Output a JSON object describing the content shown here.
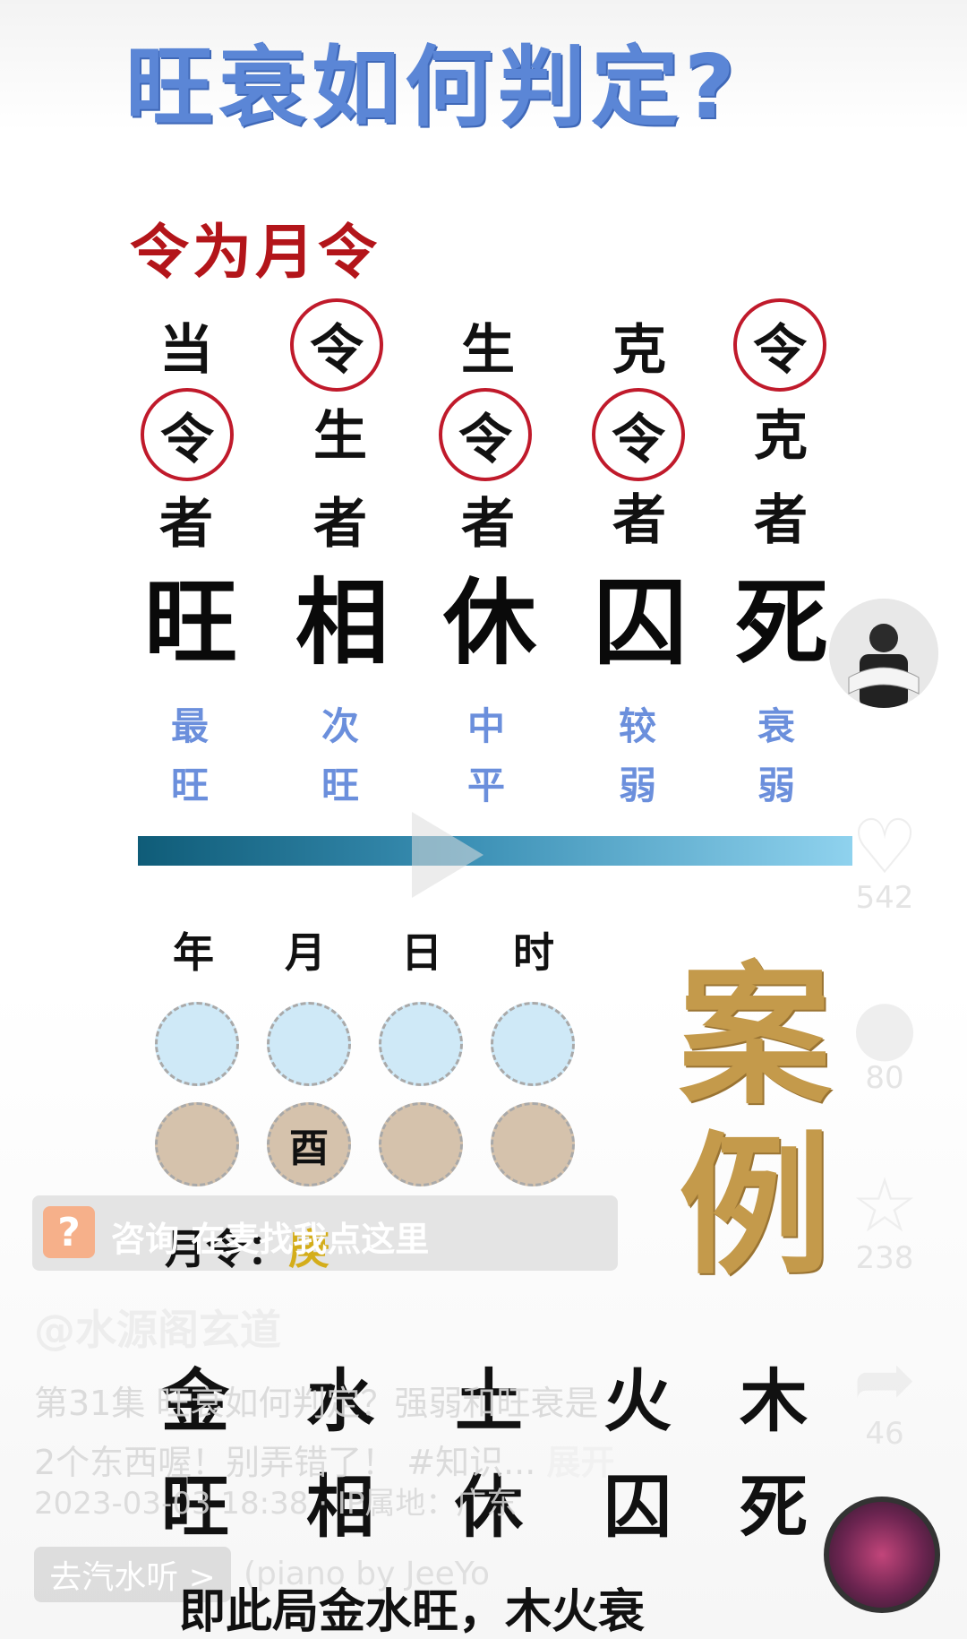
{
  "title": "旺衰如何判定?",
  "subtitle": "令为月令",
  "grid": {
    "row1": [
      "当",
      "令",
      "生",
      "克",
      "令"
    ],
    "row2": [
      "令",
      "生",
      "令",
      "令",
      "克"
    ],
    "row3": [
      "者",
      "者",
      "者",
      "者",
      "者"
    ],
    "states": [
      "旺",
      "相",
      "休",
      "囚",
      "死"
    ],
    "desc_top": [
      "最",
      "次",
      "中",
      "较",
      "衰"
    ],
    "desc_bottom": [
      "旺",
      "旺",
      "平",
      "弱",
      "弱"
    ]
  },
  "pillars": {
    "headers": [
      "年",
      "月",
      "日",
      "时"
    ],
    "month_branch": "酉"
  },
  "case_label": [
    "案",
    "例"
  ],
  "month_command": {
    "label": "月令：",
    "value": "庚"
  },
  "consult": {
    "text": "咨询 在麦找我点这里"
  },
  "author": "@水源阁玄道",
  "elements": {
    "row1": [
      "金",
      "水",
      "土",
      "火",
      "木"
    ],
    "row2": [
      "旺",
      "相",
      "休",
      "囚",
      "死"
    ]
  },
  "caption": {
    "line1": "第31集 旺衰如何判定？强弱和旺衰是",
    "line2": "2个东西喔！别弄错了！ #知识...",
    "more": "展开"
  },
  "date": "2023-03-03 18:38 · IP属地：广东",
  "music": {
    "button": "去汽水听 >",
    "track": "(piano by JeeYo"
  },
  "bottom_line": "即此局金水旺，木火衰",
  "side": {
    "like_count": "542",
    "comment_count": "80",
    "fav_count": "238",
    "share_count": "46"
  },
  "colors": {
    "title_blue": "#5b86d6",
    "subtitle_red": "#b3151a",
    "circle_red": "#c01a2b",
    "desc_blue": "#6b8fdc",
    "case_gold": "#c49a4b"
  }
}
